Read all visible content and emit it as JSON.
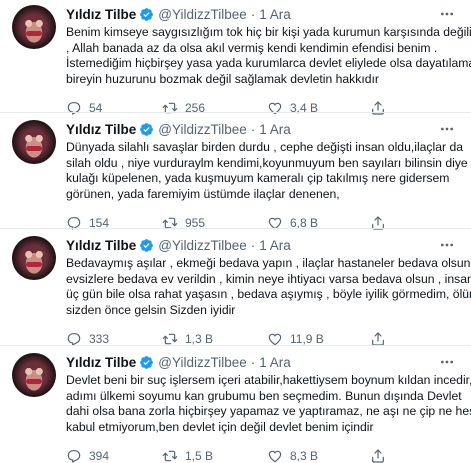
{
  "tweets": [
    {
      "name": "Yıldız Tilbe",
      "handle": "@YildizzTilbee",
      "separator": "·",
      "time": "1 Ara",
      "lines": [
        "Benim kimseye saygısızlığım tok hiç bir kişi yada kurumun karşısında değilim",
        ", Allah banada az da olsa akıl vermiş kendi kendimin efendisi benim .",
        "İstemediğim hiçbirşey yasa yada kurumlarca devlet eliylede olsa dayatılamaz,",
        "bireyin huzurunu bozmak değil sağlamak devletin hakkıdır"
      ],
      "replies": "54",
      "retweets": "256",
      "likes": "3,4 B"
    },
    {
      "name": "Yıldız Tilbe",
      "handle": "@YildizzTilbee",
      "separator": "·",
      "time": "1 Ara",
      "lines": [
        "Dünyada silahlı savaşlar birden durdu , cephe değişti insan oldu,ilaçlar da",
        "silah oldu , niye vurduraylm kendimi,koyunmuyum ben sayıları bilinsin diye",
        "kulağı küpelenen, yada kuşmuyum kameralı çip takılmış nere gidersem",
        "görünen, yada faremiyim üstümde ilaçlar denenen,"
      ],
      "replies": "154",
      "retweets": "955",
      "likes": "6,8 B"
    },
    {
      "name": "Yıldız Tilbe",
      "handle": "@YildizzTilbee",
      "separator": "·",
      "time": "1 Ara",
      "lines": [
        "Bedavaymış aşılar , ekmeği bedava yapın , ilaçlar hastaneler bedava olsun",
        "evsizlere bedava ev verildin , kimin neye ihtiyacı varsa bedava olsun , insan",
        "üç gün bile olsa rahat yaşasın , bedava aşıymış , böyle iyilik görmedim, ölüm",
        "sizden önce gelsin Sizden iyidir"
      ],
      "replies": "333",
      "retweets": "1,3 B",
      "likes": "11,9 B"
    },
    {
      "name": "Yıldız Tilbe",
      "handle": "@YildizzTilbee",
      "separator": "·",
      "time": "1 Ara",
      "lines": [
        "Devlet beni bir suç işlersem içeri atabilir,hakettiysem boynum kıldan incedir,",
        "adımı ülkemi soyumu  kan grubumu ben seçmedim. Bunun dışında Devlet",
        "dahi olsa bana zorla hiçbirşey yapamaz ve yaptıramaz, ne aşı ne çip ne hes",
        "kabul etmiyorum,ben devlet için değil devlet benim içindir"
      ],
      "replies": "394",
      "retweets": "1,5 B",
      "likes": "8,3 B"
    }
  ],
  "icons": {
    "verified": "verified-badge-icon",
    "more": "more-options-icon",
    "reply": "reply-icon",
    "retweet": "retweet-icon",
    "like": "like-heart-icon",
    "share": "share-icon"
  },
  "colors": {
    "verified": "#1d9bf0",
    "text": "#0f1419",
    "secondary": "#536471",
    "divider": "#e7e9ea"
  }
}
